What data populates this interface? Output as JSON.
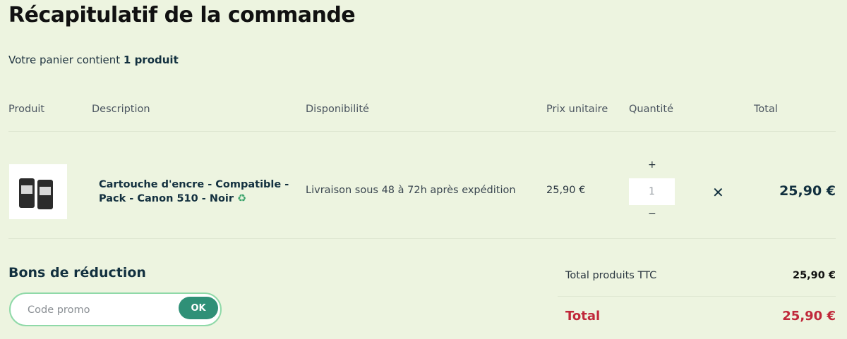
{
  "page": {
    "title": "Récapitulatif de la commande",
    "summary_prefix": "Votre panier contient ",
    "summary_count": "1 produit"
  },
  "table": {
    "headers": [
      "Produit",
      "Description",
      "Disponibilité",
      "Prix unitaire",
      "Quantité",
      "Total"
    ]
  },
  "item": {
    "name": "Cartouche d'encre - Compatible - Pack - Canon 510 - Noir",
    "recycle_icon": "♻",
    "availability": "Livraison sous 48 à 72h après expédition",
    "unit_price": "25,90 €",
    "quantity": "1",
    "qty_plus": "+",
    "qty_minus": "−",
    "remove": "✕",
    "line_total": "25,90 €"
  },
  "vouchers": {
    "title": "Bons de réduction",
    "placeholder": "Code promo",
    "button": "OK"
  },
  "totals": {
    "products_label": "Total produits TTC",
    "products_value": "25,90 €",
    "total_label": "Total",
    "total_value": "25,90 €"
  },
  "colors": {
    "background": "#edf4e0",
    "accent": "#2f9077",
    "total": "#c0283a"
  }
}
